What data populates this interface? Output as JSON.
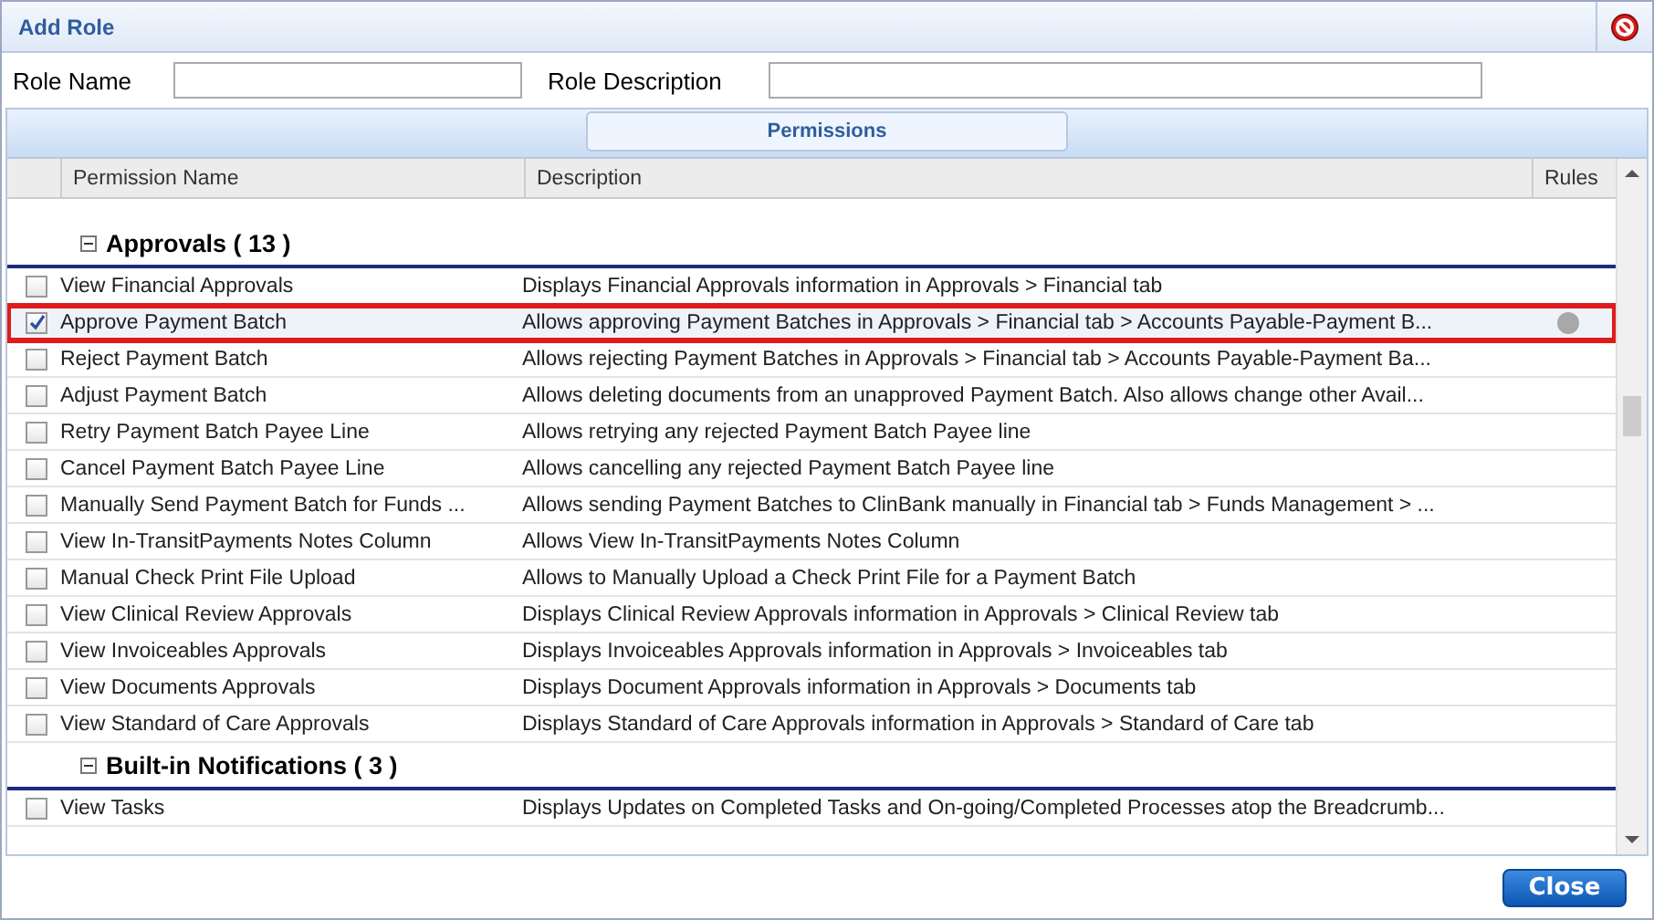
{
  "window": {
    "title": "Add Role"
  },
  "form": {
    "role_name_label": "Role Name",
    "role_description_label": "Role Description"
  },
  "tabs": [
    {
      "label": "Permissions",
      "selected": true
    }
  ],
  "table": {
    "columns": [
      "Permission Name",
      "Description",
      "Rules"
    ],
    "groups": [
      {
        "title": "Approvals ( 13 )",
        "expanded": true,
        "rows": [
          {
            "name": "View Financial Approvals",
            "description": "Displays Financial Approvals information in Approvals > Financial tab",
            "checked": false,
            "selected": false,
            "rule_set": false
          },
          {
            "name": "Approve Payment Batch",
            "description": "Allows approving Payment Batches in Approvals > Financial tab > Accounts Payable-Payment B...",
            "checked": true,
            "selected": true,
            "rule_set": true
          },
          {
            "name": "Reject Payment Batch",
            "description": "Allows rejecting Payment Batches in Approvals > Financial tab > Accounts Payable-Payment Ba...",
            "checked": false,
            "selected": false,
            "rule_set": false
          },
          {
            "name": "Adjust Payment Batch",
            "description": "Allows deleting documents from an unapproved Payment Batch. Also allows change other Avail...",
            "checked": false,
            "selected": false,
            "rule_set": false
          },
          {
            "name": "Retry Payment Batch Payee Line",
            "description": "Allows retrying any rejected Payment Batch Payee line",
            "checked": false,
            "selected": false,
            "rule_set": false
          },
          {
            "name": "Cancel Payment Batch Payee Line",
            "description": "Allows cancelling any rejected Payment Batch Payee line",
            "checked": false,
            "selected": false,
            "rule_set": false
          },
          {
            "name": "Manually Send Payment Batch for Funds ...",
            "description": "Allows sending Payment Batches to ClinBank manually in Financial tab > Funds Management > ...",
            "checked": false,
            "selected": false,
            "rule_set": false
          },
          {
            "name": "View In-TransitPayments Notes Column",
            "description": "Allows View In-TransitPayments Notes Column",
            "checked": false,
            "selected": false,
            "rule_set": false
          },
          {
            "name": "Manual Check Print File Upload",
            "description": "Allows to Manually Upload a Check Print File for a Payment Batch",
            "checked": false,
            "selected": false,
            "rule_set": false
          },
          {
            "name": "View Clinical Review Approvals",
            "description": "Displays Clinical Review Approvals information in Approvals > Clinical Review tab",
            "checked": false,
            "selected": false,
            "rule_set": false
          },
          {
            "name": "View Invoiceables Approvals",
            "description": "Displays Invoiceables Approvals information in Approvals > Invoiceables tab",
            "checked": false,
            "selected": false,
            "rule_set": false
          },
          {
            "name": "View Documents Approvals",
            "description": "Displays Document Approvals information in Approvals > Documents tab",
            "checked": false,
            "selected": false,
            "rule_set": false
          },
          {
            "name": "View Standard of Care Approvals",
            "description": "Displays Standard of Care Approvals information in Approvals > Standard of Care tab",
            "checked": false,
            "selected": false,
            "rule_set": false
          }
        ]
      },
      {
        "title": "Built-in Notifications ( 3 )",
        "expanded": true,
        "rows": [
          {
            "name": "View Tasks",
            "description": "Displays Updates on Completed Tasks and On-going/Completed Processes atop the Breadcrumb...",
            "checked": false,
            "selected": false,
            "rule_set": false
          }
        ]
      }
    ]
  },
  "buttons": [
    {
      "label": "Close"
    }
  ]
}
